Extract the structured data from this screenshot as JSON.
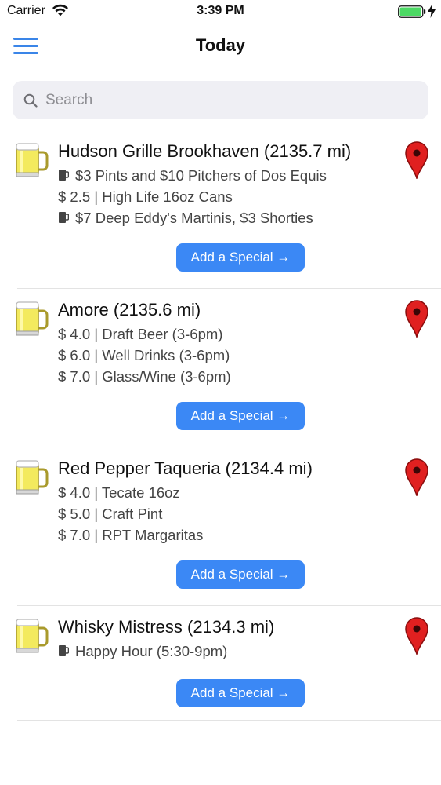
{
  "status_bar": {
    "carrier": "Carrier",
    "time": "3:39 PM",
    "icons": [
      "wifi-icon",
      "battery-icon",
      "charging-bolt-icon"
    ],
    "battery_color": "#4cd964"
  },
  "nav": {
    "title": "Today",
    "menu_icon": "hamburger-menu-icon",
    "accent_color": "#3a85e8"
  },
  "search": {
    "placeholder": "Search",
    "value": ""
  },
  "listings": [
    {
      "name": "Hudson Grille Brookhaven (2135.7 mi)",
      "specials": [
        {
          "icon": "beer-glass-icon",
          "text": "$3 Pints and $10 Pitchers of Dos Equis"
        },
        {
          "icon": "",
          "text": "$ 2.5 | High Life 16oz Cans"
        },
        {
          "icon": "beer-glass-icon",
          "text": "$7 Deep Eddy's Martinis, $3 Shorties"
        }
      ],
      "button_label": "Add a Special →"
    },
    {
      "name": "Amore (2135.6 mi)",
      "specials": [
        {
          "icon": "",
          "text": "$ 4.0 | Draft Beer (3-6pm)"
        },
        {
          "icon": "",
          "text": "$ 6.0 | Well Drinks (3-6pm)"
        },
        {
          "icon": "",
          "text": "$ 7.0 | Glass/Wine (3-6pm)"
        }
      ],
      "button_label": "Add a Special →"
    },
    {
      "name": "Red Pepper Taqueria (2134.4 mi)",
      "specials": [
        {
          "icon": "",
          "text": "$ 4.0 | Tecate 16oz"
        },
        {
          "icon": "",
          "text": "$ 5.0 | Craft Pint"
        },
        {
          "icon": "",
          "text": "$ 7.0 | RPT Margaritas"
        }
      ],
      "button_label": "Add a Special →"
    },
    {
      "name": "Whisky Mistress (2134.3 mi)",
      "specials": [
        {
          "icon": "beer-glass-icon",
          "text": "Happy Hour (5:30-9pm)"
        }
      ],
      "button_label": "Add a Special →"
    }
  ],
  "colors": {
    "button": "#3b88f5",
    "map_pin": "#e02020"
  }
}
